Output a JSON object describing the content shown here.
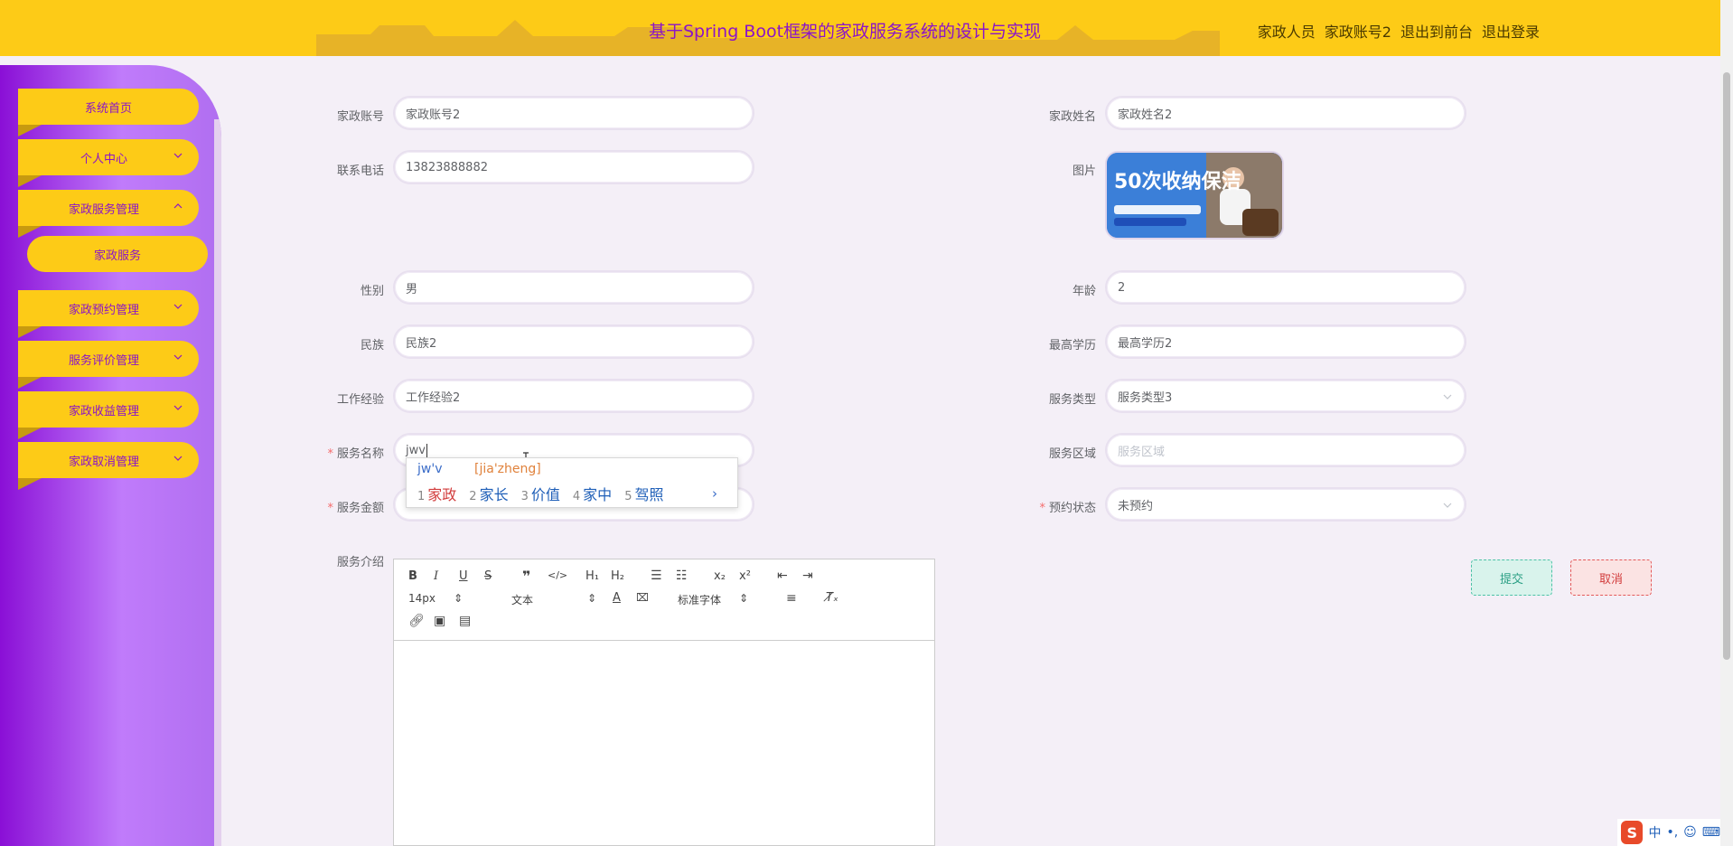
{
  "header": {
    "title": "基于Spring Boot框架的家政服务系统的设计与实现",
    "role": "家政人员",
    "username": "家政账号2",
    "front_link": "退出到前台",
    "logout_link": "退出登录"
  },
  "sidebar": {
    "items": [
      {
        "label": "系统首页"
      },
      {
        "label": "个人中心"
      },
      {
        "label": "家政服务管理"
      },
      {
        "label": "家政服务"
      },
      {
        "label": "家政预约管理"
      },
      {
        "label": "服务评价管理"
      },
      {
        "label": "家政收益管理"
      },
      {
        "label": "家政取消管理"
      }
    ]
  },
  "form": {
    "account": {
      "label": "家政账号",
      "value": "家政账号2"
    },
    "name": {
      "label": "家政姓名",
      "value": "家政姓名2"
    },
    "phone": {
      "label": "联系电话",
      "value": "13823888882"
    },
    "image": {
      "label": "图片",
      "text": "50次收纳保洁"
    },
    "gender": {
      "label": "性别",
      "value": "男"
    },
    "age": {
      "label": "年龄",
      "value": "2"
    },
    "ethnicity": {
      "label": "民族",
      "value": "民族2"
    },
    "education": {
      "label": "最高学历",
      "value": "最高学历2"
    },
    "experience": {
      "label": "工作经验",
      "value": "工作经验2"
    },
    "service_type": {
      "label": "服务类型",
      "value": "服务类型3"
    },
    "service_name": {
      "label": "服务名称",
      "value": "jwv",
      "required": "*"
    },
    "service_area": {
      "label": "服务区域",
      "placeholder": "服务区域"
    },
    "service_fee": {
      "label": "服务金额",
      "required": "*"
    },
    "booking_status": {
      "label": "预约状态",
      "value": "未预约",
      "required": "*"
    },
    "intro": {
      "label": "服务介绍"
    }
  },
  "editor": {
    "font_size": "14px",
    "text_type": "文本",
    "font_family": "标准字体"
  },
  "buttons": {
    "submit": "提交",
    "cancel": "取消"
  },
  "ime": {
    "pinyin": "jw'v",
    "hint": "[jia'zheng]",
    "candidates": [
      {
        "num": "1",
        "text": "家政"
      },
      {
        "num": "2",
        "text": "家长"
      },
      {
        "num": "3",
        "text": "价值"
      },
      {
        "num": "4",
        "text": "家中"
      },
      {
        "num": "5",
        "text": "驾照"
      }
    ],
    "next": "›"
  },
  "tray": {
    "logo": "S",
    "mode": "中"
  },
  "colors": {
    "header_bg": "#fdcb17",
    "title": "#8b14c8",
    "sidebar_start": "#8a0fd6",
    "sidebar_end": "#c07bfb"
  }
}
